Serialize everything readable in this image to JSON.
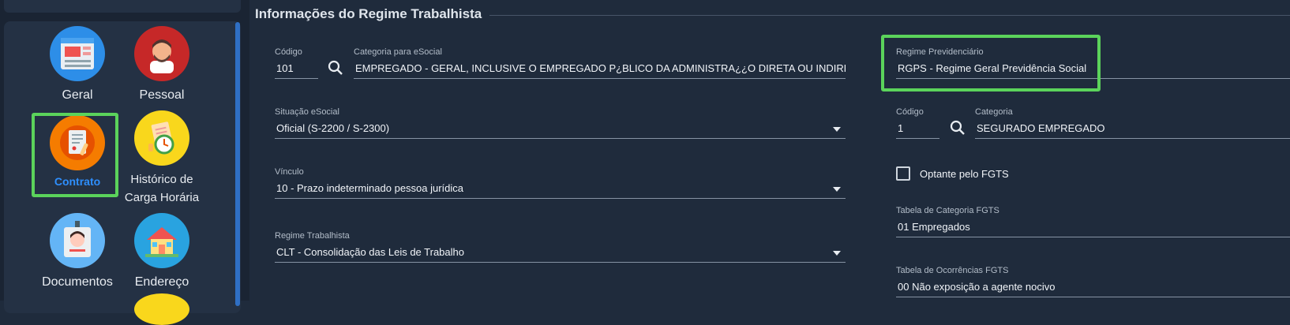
{
  "sidebar": {
    "items": [
      {
        "label": "Geral",
        "icon": "browser-window-icon",
        "active": false
      },
      {
        "label": "Pessoal",
        "icon": "person-avatar-icon",
        "active": false
      },
      {
        "label": "Contrato",
        "icon": "contract-document-icon",
        "active": true
      },
      {
        "label": "Histórico de Carga Horária",
        "icon": "clock-calendar-icon",
        "active": false
      },
      {
        "label": "Documentos",
        "icon": "id-badge-icon",
        "active": false
      },
      {
        "label": "Endereço",
        "icon": "house-icon",
        "active": false
      }
    ]
  },
  "section": {
    "title": "Informações do Regime Trabalhista"
  },
  "form": {
    "codigo": {
      "label": "Código",
      "value": "101"
    },
    "categoria_esocial": {
      "label": "Categoria para eSocial",
      "value": "EMPREGADO - GERAL, INCLUSIVE O EMPREGADO P¿BLICO DA ADMINISTRA¿¿O DIRETA OU INDIRETA CON"
    },
    "regime_previdenciario": {
      "label": "Regime Previdenciário",
      "value": "RGPS - Regime Geral Previdência Social"
    },
    "situacao_esocial": {
      "label": "Situação eSocial",
      "value": "Oficial (S-2200 / S-2300)"
    },
    "codigo_categoria": {
      "label": "Código",
      "value": "1"
    },
    "categoria": {
      "label": "Categoria",
      "value": "SEGURADO EMPREGADO"
    },
    "vinculo": {
      "label": "Vínculo",
      "value": "10 - Prazo indeterminado pessoa jurídica"
    },
    "optante_fgts": {
      "label": "Optante pelo FGTS",
      "checked": false
    },
    "tabela_categoria_fgts": {
      "label": "Tabela de Categoria FGTS",
      "value": "01 Empregados"
    },
    "regime_trabalhista": {
      "label": "Regime Trabalhista",
      "value": "CLT - Consolidação das Leis de Trabalho"
    },
    "tabela_ocorrencias_fgts": {
      "label": "Tabela de Ocorrências FGTS",
      "value": "00 Não exposição a agente nocivo"
    }
  },
  "colors": {
    "background": "#1f2b3c",
    "highlight": "#5bd35b",
    "active_text": "#2e8fff"
  }
}
